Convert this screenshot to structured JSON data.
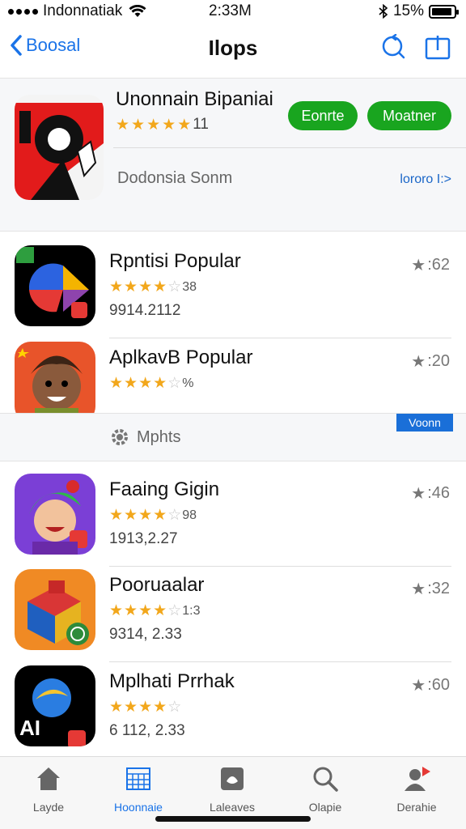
{
  "status": {
    "carrier": "Indonnatiak",
    "time": "2:33M",
    "battery": "15%"
  },
  "nav": {
    "back_label": "Boosal",
    "title": "Ilops"
  },
  "featured": {
    "title": "Unonnain Bipaniai",
    "rating": "11",
    "button1": "Eonrte",
    "button2": "Moatner",
    "subtitle": "Dodonsia Sonm",
    "link": "lororo I:>"
  },
  "apps": [
    {
      "name": "Rpntisi Popular",
      "rating": "38",
      "meta": "9914.2112",
      "score": ":62",
      "stars": 3.5
    },
    {
      "name": "AplkavB Popular",
      "rating": "%",
      "meta": "",
      "score": ":20",
      "stars": 3.5
    },
    {
      "name": "Faaing Gigin",
      "rating": "98",
      "meta": "1913,2.27",
      "score": ":46",
      "stars": 4
    },
    {
      "name": "Pooruaalar",
      "rating": "1:3",
      "meta": "9314, 2.33",
      "score": ":32",
      "stars": 4
    },
    {
      "name": "Mplhati Prrhak",
      "rating": "",
      "meta": "6 112, 2.33",
      "score": ":60",
      "stars": 3.5
    }
  ],
  "insights": {
    "label": "Mphts",
    "badge": "Voonn"
  },
  "tabbar": {
    "items": [
      {
        "label": "Layde",
        "icon": "home-icon"
      },
      {
        "label": "Hoonnaie",
        "icon": "calendar-grid-icon"
      },
      {
        "label": "Laleaves",
        "icon": "layers-icon"
      },
      {
        "label": "Olapie",
        "icon": "search-icon"
      },
      {
        "label": "Derahie",
        "icon": "profile-icon"
      }
    ]
  },
  "colors": {
    "accent": "#1a73e8",
    "green": "#19a51f",
    "star": "#f2a71b"
  }
}
